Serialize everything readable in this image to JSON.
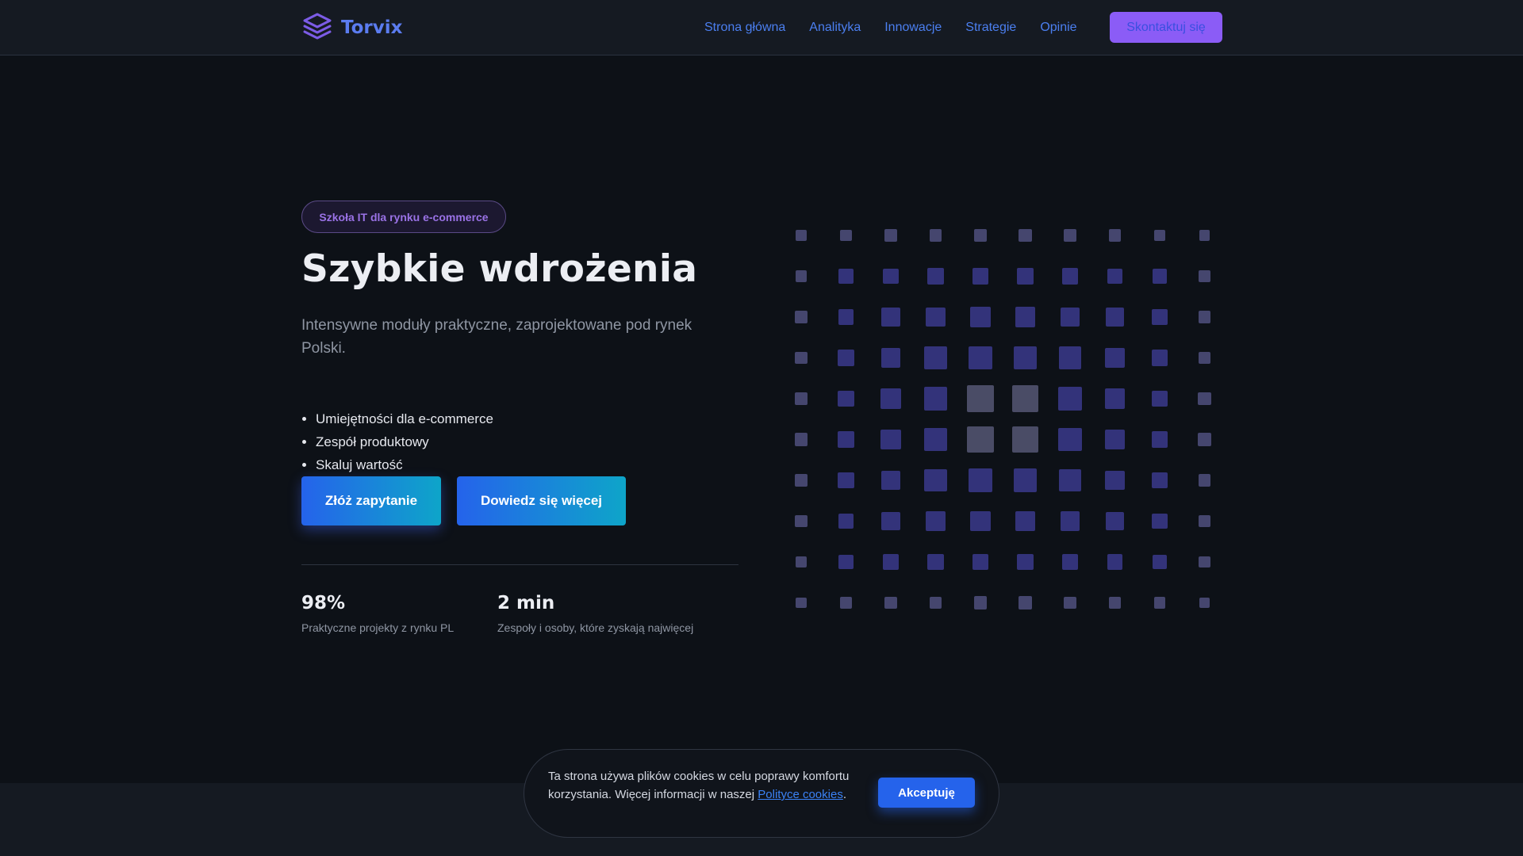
{
  "header": {
    "brand_name": "Torvix",
    "brand_icon": "layers-icon",
    "nav": [
      {
        "label": "Strona główna"
      },
      {
        "label": "Analityka"
      },
      {
        "label": "Innowacje"
      },
      {
        "label": "Strategie"
      },
      {
        "label": "Opinie"
      }
    ],
    "contact_label": "Skontaktuj się"
  },
  "hero": {
    "badge": "Szkoła IT dla rynku e-commerce",
    "title": "Szybkie wdrożenia",
    "subtitle": "Intensywne moduły praktyczne, zaprojektowane pod rynek Polski.",
    "bullets": [
      "Umiejętności dla e-commerce",
      "Zespół produktowy",
      "Skaluj wartość"
    ],
    "primary_button": "Złóż zapytanie",
    "secondary_button": "Dowiedz się więcej",
    "stats": [
      {
        "value": "98%",
        "label": "Praktyczne projekty z rynku PL"
      },
      {
        "value": "2 min",
        "label": "Zespoły i osoby, które zyskają najwięcej"
      }
    ]
  },
  "cookie": {
    "text_before": "Ta strona używa plików cookies w celu poprawy komfortu korzystania. Więcej informacji w naszej ",
    "link_label": "Polityce cookies",
    "text_after": ".",
    "accept_label": "Akceptuję"
  },
  "colors": {
    "accent_blue": "#2563eb",
    "accent_purple": "#8b5cf6",
    "square_indigo": "#33337a",
    "square_gray": "#4a4c66",
    "background": "#0d1117"
  }
}
